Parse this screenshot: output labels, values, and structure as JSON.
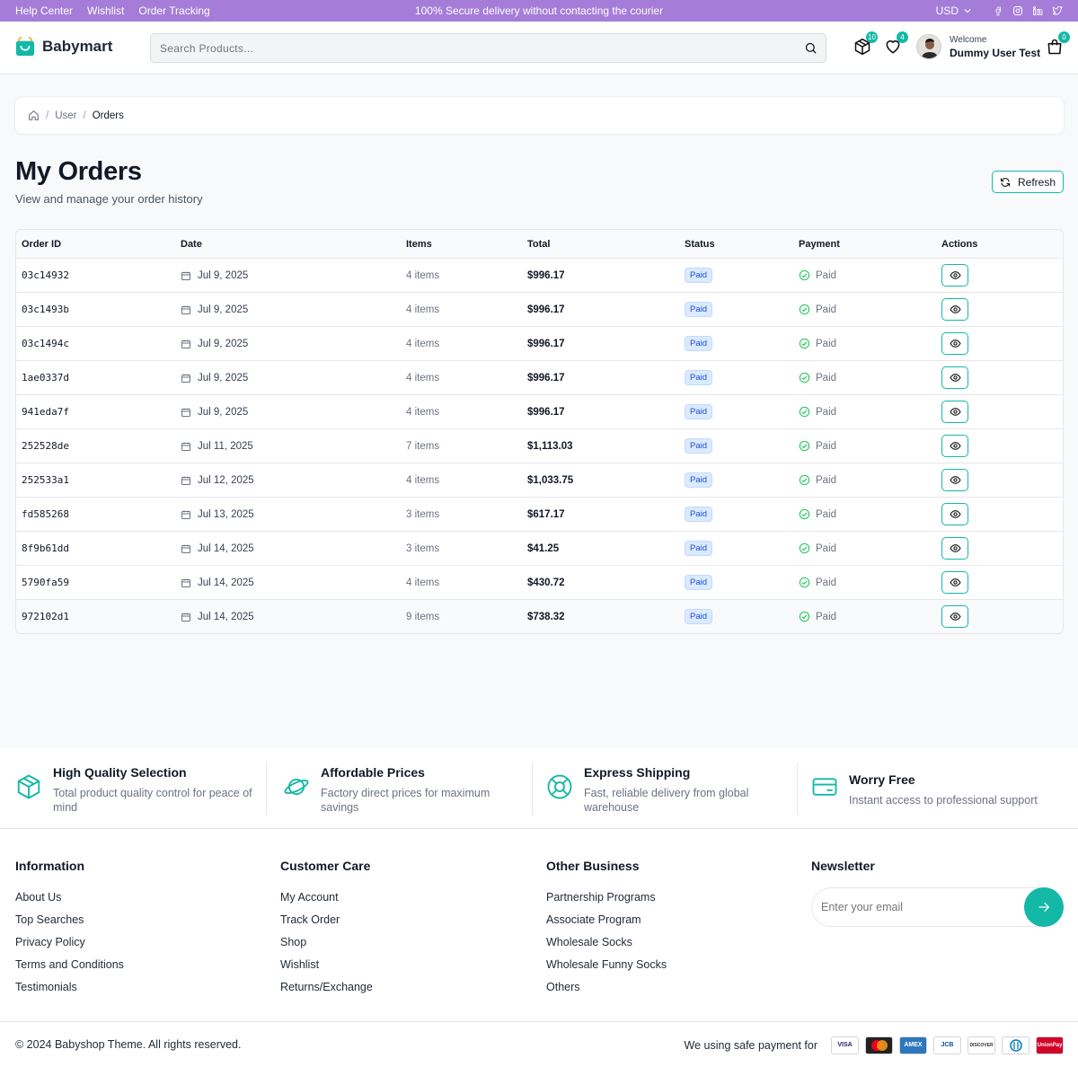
{
  "topbar": {
    "links": [
      "Help Center",
      "Wishlist",
      "Order Tracking"
    ],
    "promo": "100% Secure delivery without contacting the courier",
    "currency": "USD",
    "socials": [
      "facebook-icon",
      "instagram-icon",
      "linkedin-icon",
      "twitter-icon"
    ]
  },
  "header": {
    "brand": "Babymart",
    "search_placeholder": "Search Products...",
    "orders_badge": "10",
    "wishlist_badge": "4",
    "cart_badge": "0",
    "welcome": "Welcome",
    "user_name": "Dummy User Test"
  },
  "breadcrumb": {
    "items": [
      "User",
      "Orders"
    ]
  },
  "page": {
    "title": "My Orders",
    "subtitle": "View and manage your order history",
    "refresh_label": "Refresh"
  },
  "table": {
    "headers": [
      "Order ID",
      "Date",
      "Items",
      "Total",
      "Status",
      "Payment",
      "Actions"
    ],
    "rows": [
      {
        "id": "03c14932",
        "date": "Jul 9, 2025",
        "items": "4 items",
        "total": "$996.17",
        "status": "Paid",
        "payment": "Paid"
      },
      {
        "id": "03c1493b",
        "date": "Jul 9, 2025",
        "items": "4 items",
        "total": "$996.17",
        "status": "Paid",
        "payment": "Paid"
      },
      {
        "id": "03c1494c",
        "date": "Jul 9, 2025",
        "items": "4 items",
        "total": "$996.17",
        "status": "Paid",
        "payment": "Paid"
      },
      {
        "id": "1ae0337d",
        "date": "Jul 9, 2025",
        "items": "4 items",
        "total": "$996.17",
        "status": "Paid",
        "payment": "Paid"
      },
      {
        "id": "941eda7f",
        "date": "Jul 9, 2025",
        "items": "4 items",
        "total": "$996.17",
        "status": "Paid",
        "payment": "Paid"
      },
      {
        "id": "252528de",
        "date": "Jul 11, 2025",
        "items": "7 items",
        "total": "$1,113.03",
        "status": "Paid",
        "payment": "Paid"
      },
      {
        "id": "252533a1",
        "date": "Jul 12, 2025",
        "items": "4 items",
        "total": "$1,033.75",
        "status": "Paid",
        "payment": "Paid"
      },
      {
        "id": "fd585268",
        "date": "Jul 13, 2025",
        "items": "3 items",
        "total": "$617.17",
        "status": "Paid",
        "payment": "Paid"
      },
      {
        "id": "8f9b61dd",
        "date": "Jul 14, 2025",
        "items": "3 items",
        "total": "$41.25",
        "status": "Paid",
        "payment": "Paid"
      },
      {
        "id": "5790fa59",
        "date": "Jul 14, 2025",
        "items": "4 items",
        "total": "$430.72",
        "status": "Paid",
        "payment": "Paid"
      },
      {
        "id": "972102d1",
        "date": "Jul 14, 2025",
        "items": "9 items",
        "total": "$738.32",
        "status": "Paid",
        "payment": "Paid"
      }
    ]
  },
  "features": [
    {
      "title": "High Quality Selection",
      "desc": "Total product quality control for peace of mind",
      "icon": "box-icon"
    },
    {
      "title": "Affordable Prices",
      "desc": "Factory direct prices for maximum savings",
      "icon": "planet-icon"
    },
    {
      "title": "Express Shipping",
      "desc": "Fast, reliable delivery from global warehouse",
      "icon": "lifebuoy-icon"
    },
    {
      "title": "Worry Free",
      "desc": "Instant access to professional support",
      "icon": "credit-card-icon"
    }
  ],
  "footer": {
    "columns": [
      {
        "title": "Information",
        "items": [
          "About Us",
          "Top Searches",
          "Privacy Policy",
          "Terms and Conditions",
          "Testimonials"
        ]
      },
      {
        "title": "Customer Care",
        "items": [
          "My Account",
          "Track Order",
          "Shop",
          "Wishlist",
          "Returns/Exchange"
        ]
      },
      {
        "title": "Other Business",
        "items": [
          "Partnership Programs",
          "Associate Program",
          "Wholesale Socks",
          "Wholesale Funny Socks",
          "Others"
        ]
      }
    ],
    "newsletter_title": "Newsletter",
    "newsletter_placeholder": "Enter your email",
    "copyright": "© 2024 Babyshop Theme. All rights reserved.",
    "payment_text": "We using safe payment for",
    "cards": [
      {
        "label": "VISA",
        "color": "#1a1f71"
      },
      {
        "label": "",
        "color": "#eb001b"
      },
      {
        "label": "AMEX",
        "color": "#2e77bb"
      },
      {
        "label": "JCB",
        "color": "#0e4c96"
      },
      {
        "label": "DISCOVER",
        "color": "#333333"
      },
      {
        "label": "",
        "color": "#0079be"
      },
      {
        "label": "UnionPay",
        "color": "#d10429"
      }
    ]
  },
  "colors": {
    "topbar": "#a57dd8",
    "accent": "#14b8a6",
    "status_pill": "#dbeafe"
  }
}
